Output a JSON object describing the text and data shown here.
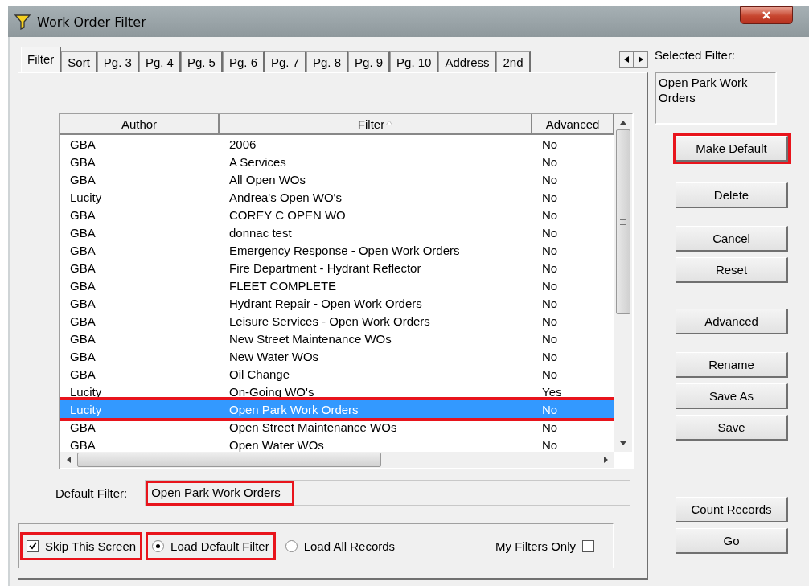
{
  "window": {
    "title": "Work Order Filter"
  },
  "tabs": [
    {
      "label": "Filter",
      "selected": true
    },
    {
      "label": "Sort",
      "selected": false
    },
    {
      "label": "Pg. 3",
      "selected": false
    },
    {
      "label": "Pg. 4",
      "selected": false
    },
    {
      "label": "Pg. 5",
      "selected": false
    },
    {
      "label": "Pg. 6",
      "selected": false
    },
    {
      "label": "Pg. 7",
      "selected": false
    },
    {
      "label": "Pg. 8",
      "selected": false
    },
    {
      "label": "Pg. 9",
      "selected": false
    },
    {
      "label": "Pg. 10",
      "selected": false
    },
    {
      "label": "Address",
      "selected": false
    },
    {
      "label": "2nd",
      "selected": false
    }
  ],
  "table": {
    "columns": [
      {
        "label": "Author",
        "sorted": false
      },
      {
        "label": "Filter",
        "sorted": true
      },
      {
        "label": "Advanced",
        "sorted": false
      }
    ],
    "rows": [
      {
        "author": "GBA",
        "filter": "2006",
        "advanced": "No",
        "selected": false,
        "highlighted": false
      },
      {
        "author": "GBA",
        "filter": "A Services",
        "advanced": "No",
        "selected": false,
        "highlighted": false
      },
      {
        "author": "GBA",
        "filter": "All Open WOs",
        "advanced": "No",
        "selected": false,
        "highlighted": false
      },
      {
        "author": "Lucity",
        "filter": "Andrea's Open WO's",
        "advanced": "No",
        "selected": false,
        "highlighted": false
      },
      {
        "author": "GBA",
        "filter": "COREY C OPEN WO",
        "advanced": "No",
        "selected": false,
        "highlighted": false
      },
      {
        "author": "GBA",
        "filter": "donnac test",
        "advanced": "No",
        "selected": false,
        "highlighted": false
      },
      {
        "author": "GBA",
        "filter": "Emergency Response - Open Work Orders",
        "advanced": "No",
        "selected": false,
        "highlighted": false
      },
      {
        "author": "GBA",
        "filter": "Fire Department - Hydrant Reflector",
        "advanced": "No",
        "selected": false,
        "highlighted": false
      },
      {
        "author": "GBA",
        "filter": "FLEET COMPLETE",
        "advanced": "No",
        "selected": false,
        "highlighted": false
      },
      {
        "author": "GBA",
        "filter": "Hydrant Repair - Open Work Orders",
        "advanced": "No",
        "selected": false,
        "highlighted": false
      },
      {
        "author": "GBA",
        "filter": "Leisure Services - Open Work Orders",
        "advanced": "No",
        "selected": false,
        "highlighted": false
      },
      {
        "author": "GBA",
        "filter": "New Street Maintenance WOs",
        "advanced": "No",
        "selected": false,
        "highlighted": false
      },
      {
        "author": "GBA",
        "filter": "New Water WOs",
        "advanced": "No",
        "selected": false,
        "highlighted": false
      },
      {
        "author": "GBA",
        "filter": "Oil Change",
        "advanced": "No",
        "selected": false,
        "highlighted": false
      },
      {
        "author": "Lucity",
        "filter": "On-Going WO's",
        "advanced": "Yes",
        "selected": false,
        "highlighted": false
      },
      {
        "author": "Lucity",
        "filter": "Open Park Work Orders",
        "advanced": "No",
        "selected": true,
        "highlighted": true
      },
      {
        "author": "GBA",
        "filter": "Open Street Maintenance WOs",
        "advanced": "No",
        "selected": false,
        "highlighted": false
      },
      {
        "author": "GBA",
        "filter": "Open Water WOs",
        "advanced": "No",
        "selected": false,
        "highlighted": false
      }
    ]
  },
  "default_filter": {
    "label": "Default Filter:",
    "value": "Open Park Work Orders",
    "highlighted": true
  },
  "options": {
    "skip_screen": {
      "label": "Skip This Screen",
      "checked": true,
      "highlighted": true
    },
    "load": [
      {
        "label": "Load Default Filter",
        "selected": true,
        "highlighted": true
      },
      {
        "label": "Load All Records",
        "selected": false,
        "highlighted": false
      }
    ],
    "my_filters_only": {
      "label": "My Filters Only",
      "checked": false
    }
  },
  "selected_filter": {
    "label": "Selected Filter:",
    "value": "Open Park Work Orders"
  },
  "button_groups": [
    [
      {
        "label": "Make Default",
        "highlighted": true
      }
    ],
    [
      {
        "label": "Delete",
        "highlighted": false
      }
    ],
    [
      {
        "label": "Cancel",
        "highlighted": false
      },
      {
        "label": "Reset",
        "highlighted": false
      }
    ],
    [
      {
        "label": "Advanced",
        "highlighted": false
      }
    ],
    [
      {
        "label": "Rename",
        "highlighted": false
      },
      {
        "label": "Save As",
        "highlighted": false
      },
      {
        "label": "Save",
        "highlighted": false
      }
    ],
    [
      {
        "label": "Count Records",
        "highlighted": false
      },
      {
        "label": "Go",
        "highlighted": false
      }
    ]
  ]
}
